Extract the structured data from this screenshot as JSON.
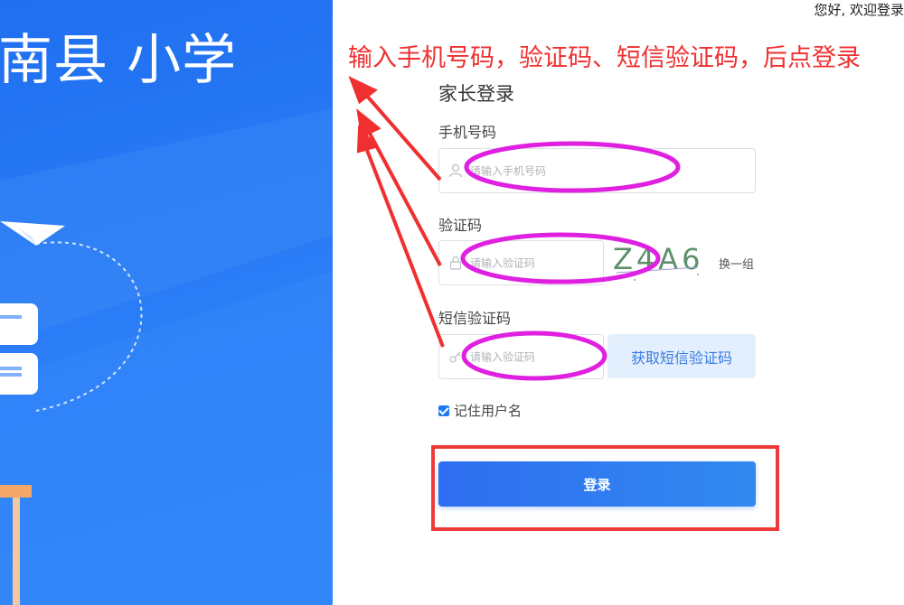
{
  "banner": {
    "title": "南县 小学"
  },
  "header": {
    "greeting": "您好, 欢迎登录"
  },
  "annotation": {
    "text": "输入手机号码，验证码、短信验证码，后点登录"
  },
  "form": {
    "title": "家长登录",
    "phone": {
      "label": "手机号码",
      "placeholder": "请输入手机号码",
      "icon": "user-icon"
    },
    "captcha": {
      "label": "验证码",
      "placeholder": "请输入验证码",
      "icon": "lock-icon",
      "image_text": "Z4A6",
      "refresh_label": "换一组"
    },
    "sms": {
      "label": "短信验证码",
      "placeholder": "请输入验证码",
      "icon": "key-icon",
      "button_label": "获取短信验证码"
    },
    "remember": {
      "label": "记住用户名",
      "checked": true
    },
    "login_label": "登录"
  },
  "colors": {
    "banner": "#2a7cf6",
    "annotation": "#f03030",
    "highlight": "#e020e0",
    "primary": "#2f7af0"
  }
}
